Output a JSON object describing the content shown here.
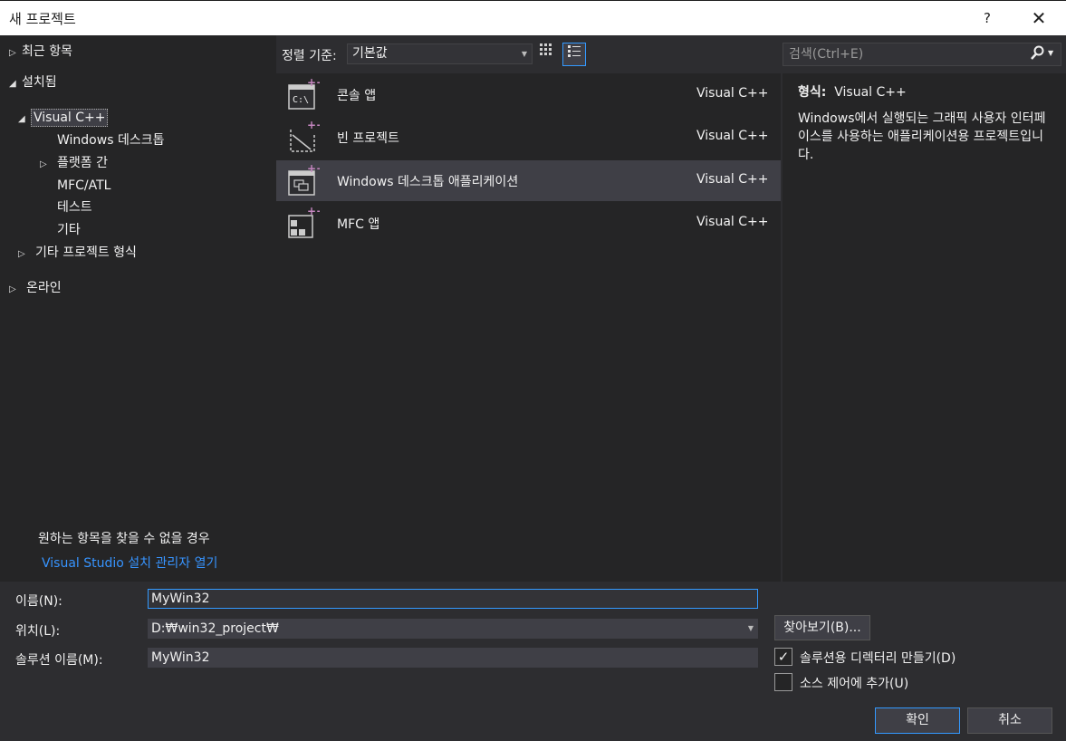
{
  "window": {
    "title": "새 프로젝트",
    "help": "?",
    "close": "✕"
  },
  "tree": {
    "recent": "최근 항목",
    "installed": "설치됨",
    "visual_cpp": "Visual C++",
    "windows_desktop": "Windows 데스크톱",
    "cross_platform": "플랫폼 간",
    "mfc_atl": "MFC/ATL",
    "test": "테스트",
    "other": "기타",
    "other_types": "기타 프로젝트 형식",
    "online": "온라인"
  },
  "hint": {
    "text": "원하는 항목을 찾을 수 없을 경우",
    "link": "Visual Studio 설치 관리자 열기"
  },
  "sort": {
    "label": "정렬 기준:",
    "value": "기본값"
  },
  "templates": [
    {
      "name": "콘솔 앱",
      "lang": "Visual C++",
      "icon": "console-app-icon"
    },
    {
      "name": "빈 프로젝트",
      "lang": "Visual C++",
      "icon": "empty-project-icon"
    },
    {
      "name": "Windows 데스크톱 애플리케이션",
      "lang": "Visual C++",
      "icon": "windows-desktop-app-icon"
    },
    {
      "name": "MFC 앱",
      "lang": "Visual C++",
      "icon": "mfc-app-icon"
    }
  ],
  "search": {
    "placeholder": "검색(Ctrl+E)"
  },
  "details": {
    "type_label": "형식:",
    "type_value": "Visual C++",
    "description": "Windows에서 실행되는 그래픽 사용자 인터페이스를 사용하는 애플리케이션용 프로젝트입니다."
  },
  "form": {
    "name_label": "이름(N):",
    "name_value": "MyWin32",
    "location_label": "위치(L):",
    "location_value": "D:₩win32_project₩",
    "solution_label": "솔루션 이름(M):",
    "solution_value": "MyWin32",
    "browse": "찾아보기(B)...",
    "create_dir": "솔루션용 디렉터리 만들기(D)",
    "source_control": "소스 제어에 추가(U)",
    "ok": "확인",
    "cancel": "취소"
  },
  "colors": {
    "accent": "#3399ff",
    "link": "#3794ff",
    "background": "#2d2d30",
    "panel": "#252526"
  }
}
